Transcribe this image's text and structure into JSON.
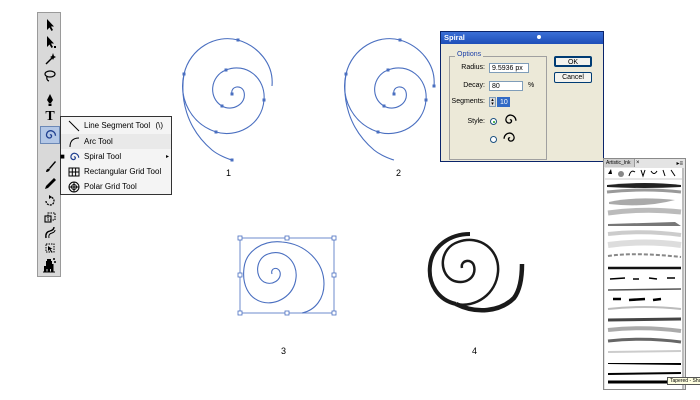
{
  "toolbox": {
    "tools": [
      {
        "name": "selection-tool",
        "icon": "arrow-icon"
      },
      {
        "name": "direct-selection-tool",
        "icon": "hollow-arrow-icon"
      },
      {
        "name": "magic-wand-tool",
        "icon": "magic-wand-icon"
      },
      {
        "name": "lasso-tool",
        "icon": "lasso-icon"
      },
      {
        "name": "pen-tool",
        "icon": "pen-icon"
      },
      {
        "name": "type-tool",
        "icon": "type-icon",
        "glyph": "T"
      },
      {
        "name": "spiral-tool",
        "icon": "spiral-icon",
        "active": true
      },
      {
        "name": "paintbrush-tool",
        "icon": "paintbrush-icon"
      },
      {
        "name": "pencil-tool",
        "icon": "pencil-icon"
      },
      {
        "name": "rotate-tool",
        "icon": "rotate-icon"
      },
      {
        "name": "scale-tool",
        "icon": "scale-icon"
      },
      {
        "name": "warp-tool",
        "icon": "warp-icon"
      },
      {
        "name": "free-transform-tool",
        "icon": "free-transform-icon"
      },
      {
        "name": "symbol-sprayer-tool",
        "icon": "symbol-sprayer-icon"
      },
      {
        "name": "graph-tool",
        "icon": "bar-graph-icon"
      }
    ]
  },
  "flyout": {
    "items": [
      {
        "label": "Line Segment Tool",
        "shortcut": "(\\)",
        "icon": "line-segment-icon"
      },
      {
        "label": "Arc Tool",
        "icon": "arc-icon"
      },
      {
        "label": "Spiral Tool",
        "icon": "spiral-icon",
        "current": true
      },
      {
        "label": "Rectangular Grid Tool",
        "icon": "rectangular-grid-icon"
      },
      {
        "label": "Polar Grid Tool",
        "icon": "polar-grid-icon"
      }
    ]
  },
  "figures": {
    "labels": [
      "1",
      "2",
      "3",
      "4"
    ]
  },
  "dialog": {
    "title": "Spiral",
    "options_legend": "Options",
    "radius_label": "Radius:",
    "radius_value": "9.5936 px",
    "decay_label": "Decay:",
    "decay_value": "80",
    "decay_unit": "%",
    "segments_label": "Segments:",
    "segments_value": "10",
    "style_label": "Style:",
    "ok_label": "OK",
    "cancel_label": "Cancel"
  },
  "brush_panel": {
    "tab_label": "Artistic_Ink",
    "tab_close": "×",
    "menu_icon": "panel-menu-icon",
    "tooltip": "Tapered - Sharp"
  }
}
